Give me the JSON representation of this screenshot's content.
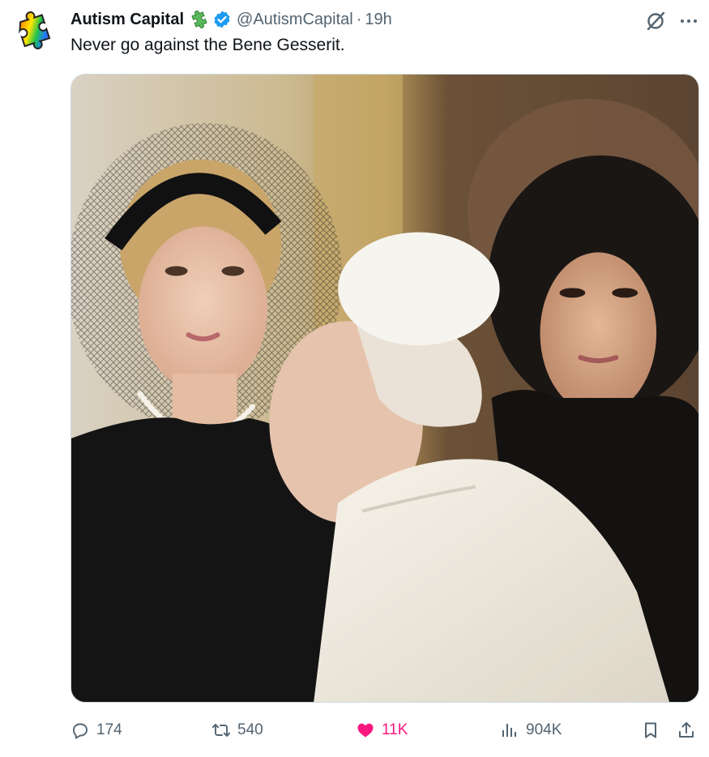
{
  "tweet": {
    "author_name": "Autism Capital",
    "handle": "@AutismCapital",
    "separator": "·",
    "timestamp": "19h",
    "text": "Never go against the Bene Gesserit.",
    "avatar_icon": "rainbow-puzzle-icon",
    "badge_icon": "green-puzzle-icon",
    "verified_icon": "verified-badge-icon"
  },
  "actions": {
    "replies": "174",
    "reposts": "540",
    "likes": "11K",
    "views": "904K"
  },
  "colors": {
    "like": "#f91880",
    "verified": "#1d9bf0",
    "muted": "#536471",
    "text": "#0f1419"
  }
}
